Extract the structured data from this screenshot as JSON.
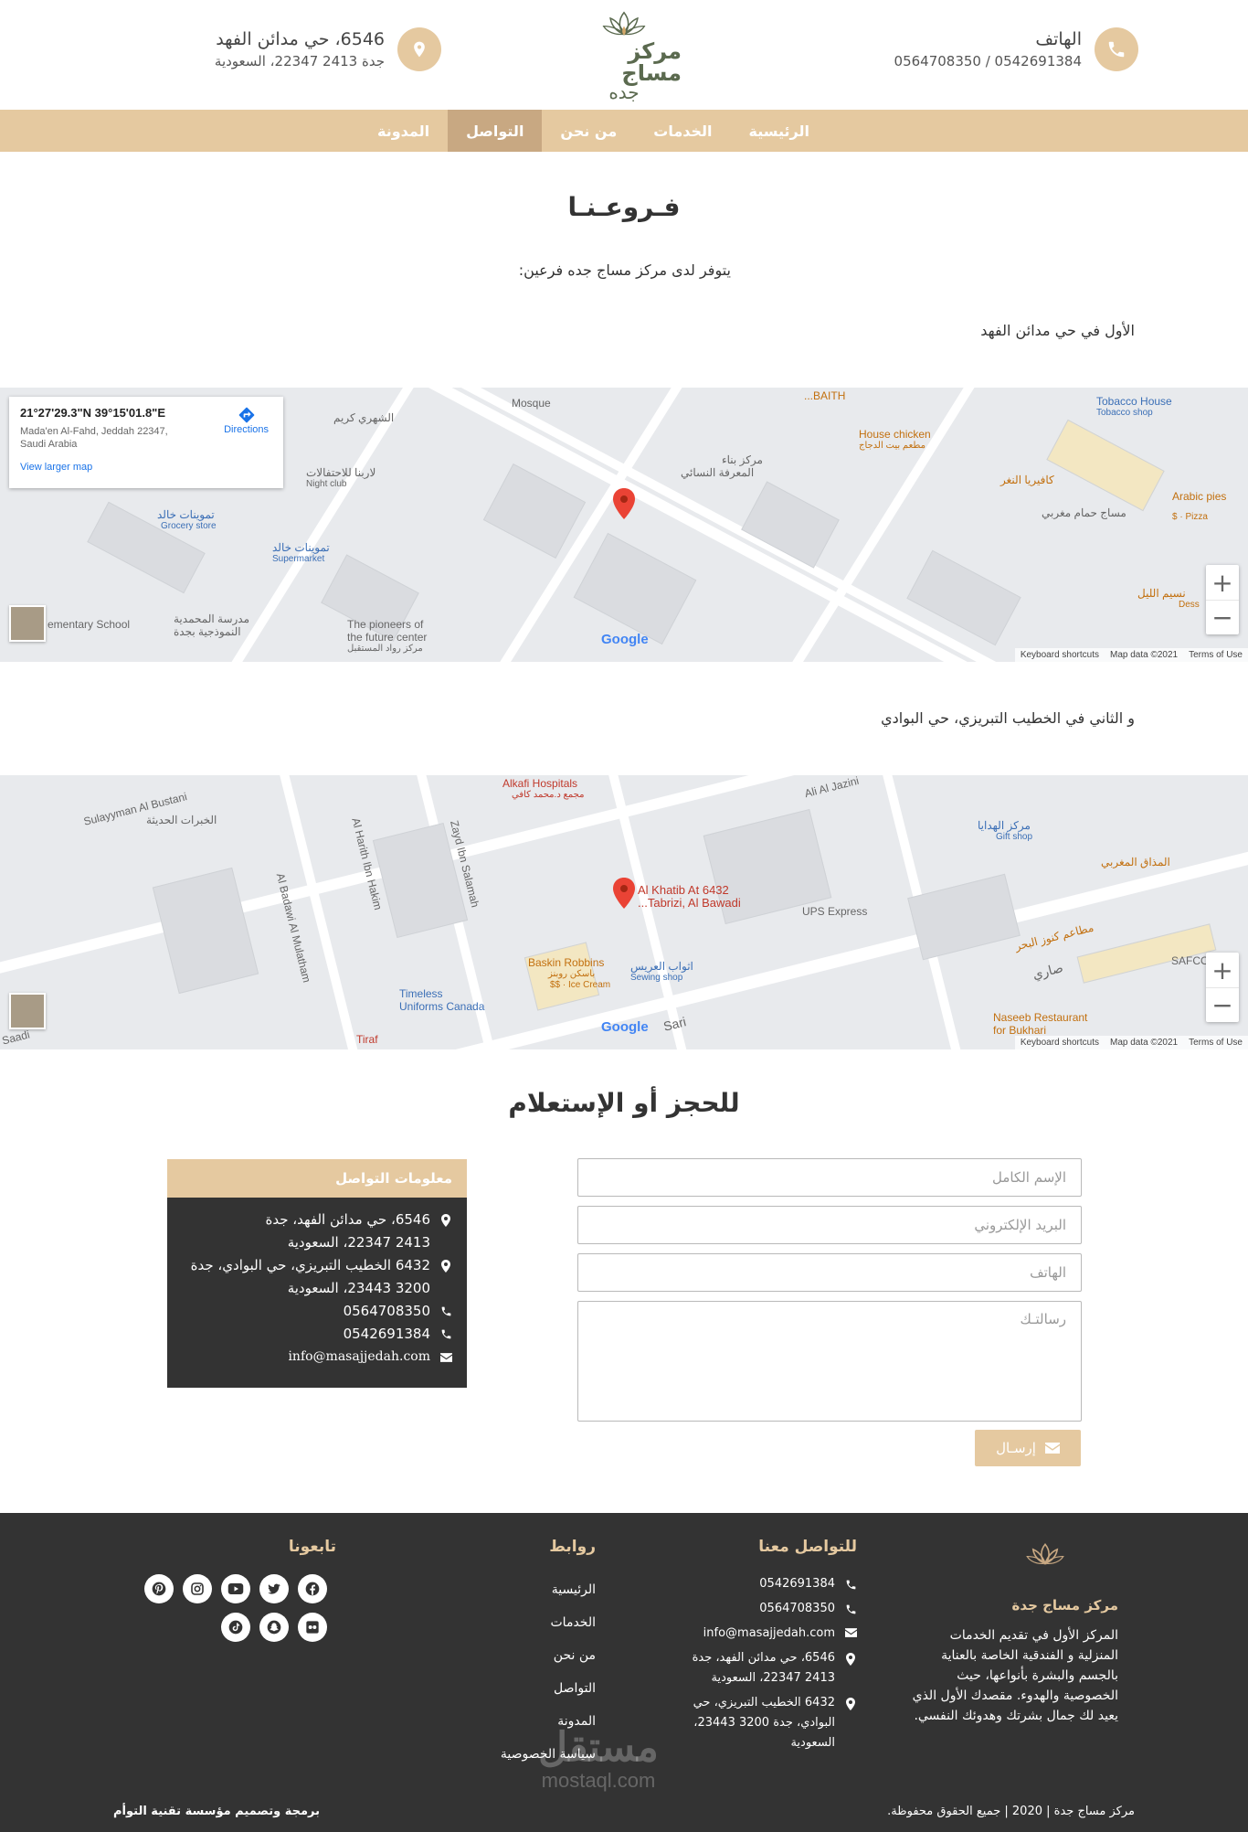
{
  "header": {
    "phone_title": "الهاتف",
    "phone_numbers": "0564708350 / 0542691384",
    "address_line1": "6546، حي مدائن الفهد",
    "address_line2": "جدة 2413 22347، السعودية",
    "logo_name": "مركز مساج",
    "logo_sub": "جده",
    "accent_color": "#e5c9a0"
  },
  "nav": {
    "items": [
      {
        "label": "الرئيسية"
      },
      {
        "label": "الخدمات"
      },
      {
        "label": "من نحن"
      },
      {
        "label": "التواصل"
      },
      {
        "label": "المدونة"
      }
    ],
    "active": "التواصل"
  },
  "branches": {
    "title": "فـروعـنـا",
    "intro": "يتوفر لدى مركز مساج جده فرعين:",
    "first": "الأول في حي مدائن الفهد",
    "second": "و الثاني في الخطيب التبريزي، حي البوادي"
  },
  "map1": {
    "coords": "21°27'29.3\"N 39°15'01.8\"E",
    "address": "Mada'en Al-Fahd, Jeddah 22347, Saudi Arabia",
    "larger_map": "View larger map",
    "directions": "Directions",
    "labels": [
      "Mosque",
      "BAITH...",
      "House chicken",
      "مطعم بيت الدجاج",
      "Tobacco House",
      "Tobacco shop",
      "الشهري كريم",
      "مركز بناء",
      "المعرفة النسائي",
      "كافيريا النغر",
      "Arabic pies",
      "Pizza · $",
      "مساج حمام مغربي",
      "لاربنا للاحتفالات",
      "Night club",
      "تموينات خالد",
      "Grocery store",
      "تموينات خالد",
      "Supermarket",
      "ementary School",
      "مدرسة المحمدية",
      "النموذجية بجدة",
      "The pioneers of",
      "the future center",
      "مركز رواد المستقبل",
      "نسيم الليل",
      "Dess"
    ],
    "footer": [
      "Keyboard shortcuts",
      "Map data ©2021",
      "Terms of Use"
    ],
    "google": "Google"
  },
  "map2": {
    "pin_label_1": "6432 Al Khatib At",
    "pin_label_2": "Tabrizi, Al Bawadi...",
    "labels": [
      "Alkafi Hospitals",
      "مجمع د.محمد كافي",
      "Ali Al Jazini",
      "Sulayyman Al Bustani",
      "الخبرات الحديثة",
      "Al Harith Ibn Hakim",
      "Zayd Ibn Salamah",
      "Al Badawi Al Mulatham",
      "مركز الهدايا",
      "Gift shop",
      "المذاق المغربي",
      "UPS Express",
      "مطاعم كنوز البحر",
      "Baskin Robbins",
      "باسكن روبنز",
      "Ice Cream · $$",
      "اثواب العريس",
      "Sewing shop",
      "Timeless",
      "Uniforms Canada",
      "Naseeb Restaurant",
      "for Bukhari",
      "Sari",
      "صاري",
      "Tiraf",
      "Saadi",
      "SAFCO"
    ],
    "footer": [
      "Keyboard shortcuts",
      "Map data ©2021",
      "Terms of Use"
    ],
    "google": "Google"
  },
  "booking": {
    "title": "للحجز أو الإستعلام",
    "name_placeholder": "الإسم الكامل",
    "email_placeholder": "البريد الإلكتروني",
    "phone_placeholder": "الهاتف",
    "message_placeholder": "رسالتـك",
    "send_label": "إرسـال"
  },
  "contact_info": {
    "title": "معلومات التواصل",
    "address1_line1": "6546، حي مدائن الفهد، جدة",
    "address1_line2": "2413 22347، السعودية",
    "address2_line1": "6432 الخطيب التبريزي، حي البوادي، جدة",
    "address2_line2": "3200 23443، السعودية",
    "phone1": "0564708350",
    "phone2": "0542691384",
    "email": "info@masajjedah.com"
  },
  "footer": {
    "brand": "مركز مساج جدة",
    "about": "المركز الأول في تقديم الخدمات المنزلية و الفندقية الخاصة بالعناية بالجسم والبشرة بأنواعها، حيث الخصوصية والهدوء. مقصدك الأول الذي يعيد لك جمال بشرتك وهدوئك النفسي.",
    "contact_title": "للتواصل معنا",
    "phone1": "0542691384",
    "phone2": "0564708350",
    "email": "info@masajjedah.com",
    "address1_line1": "6546، حي مدائن الفهد، جدة",
    "address1_line2": "2413 22347، السعودية",
    "address2_line1": "6432 الخطيب التبريزي، حي",
    "address2_line2": "البوادي، جدة 3200 23443،",
    "address2_line3": "السعودية",
    "links_title": "روابط",
    "links": [
      "الرئيسية",
      "الخدمات",
      "من نحن",
      "التواصل",
      "المدونة",
      "سياسة الخصوصية"
    ],
    "follow_title": "تابعونا",
    "social_icons": [
      "facebook-icon",
      "twitter-icon",
      "youtube-icon",
      "instagram-icon",
      "pinterest-icon",
      "flickr-icon",
      "snapchat-icon",
      "tiktok-icon"
    ],
    "copyright": "مركز مساج جدة | 2020 | جميع الحقوق محفوظة.",
    "credit": "برمجة وتصميم مؤسسة تقنية التوأم",
    "watermark": "مستقل",
    "watermark_url": "mostaql.com"
  }
}
